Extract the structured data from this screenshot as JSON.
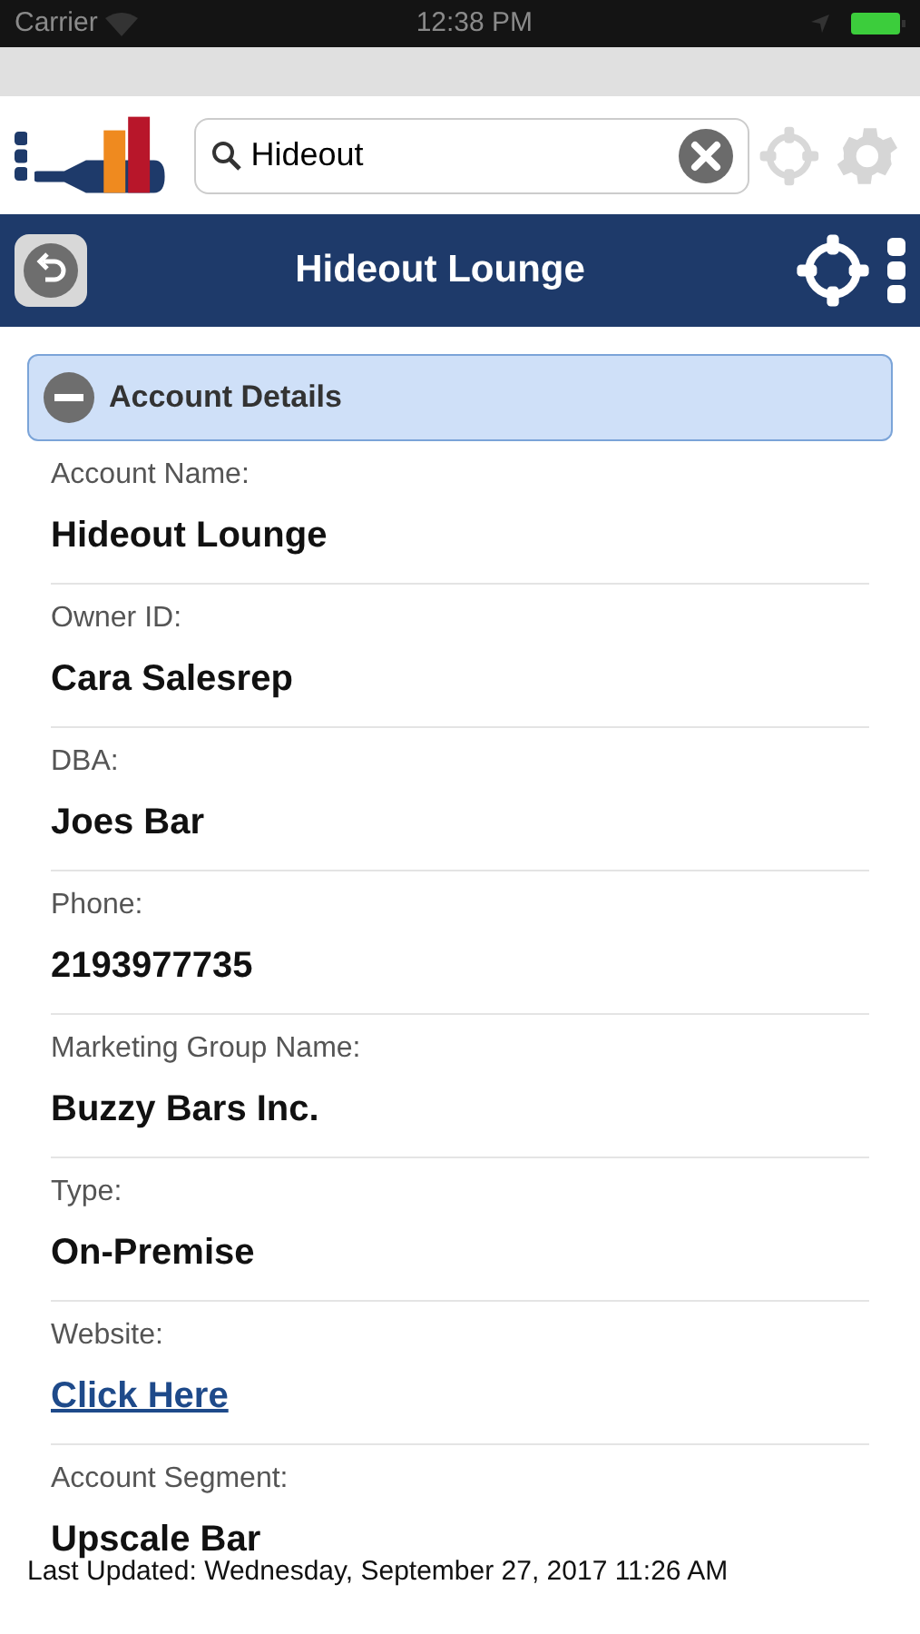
{
  "status_bar": {
    "carrier": "Carrier",
    "time": "12:38 PM"
  },
  "search": {
    "value": "Hideout"
  },
  "nav": {
    "title": "Hideout Lounge"
  },
  "section": {
    "title": "Account Details",
    "expanded": true
  },
  "fields": [
    {
      "label": "Account Name:",
      "value": "Hideout Lounge",
      "kind": "text"
    },
    {
      "label": "Owner ID:",
      "value": "Cara Salesrep",
      "kind": "text"
    },
    {
      "label": "DBA:",
      "value": "Joes Bar",
      "kind": "text"
    },
    {
      "label": "Phone:",
      "value": "2193977735",
      "kind": "text"
    },
    {
      "label": "Marketing Group Name:",
      "value": "Buzzy Bars Inc.",
      "kind": "text"
    },
    {
      "label": "Type:",
      "value": "On-Premise",
      "kind": "text"
    },
    {
      "label": "Website:",
      "value": "Click Here",
      "kind": "link"
    },
    {
      "label": "Account Segment:",
      "value": "Upscale Bar",
      "kind": "text"
    }
  ],
  "footer": "Last Updated: Wednesday, September 27, 2017 11:26 AM"
}
